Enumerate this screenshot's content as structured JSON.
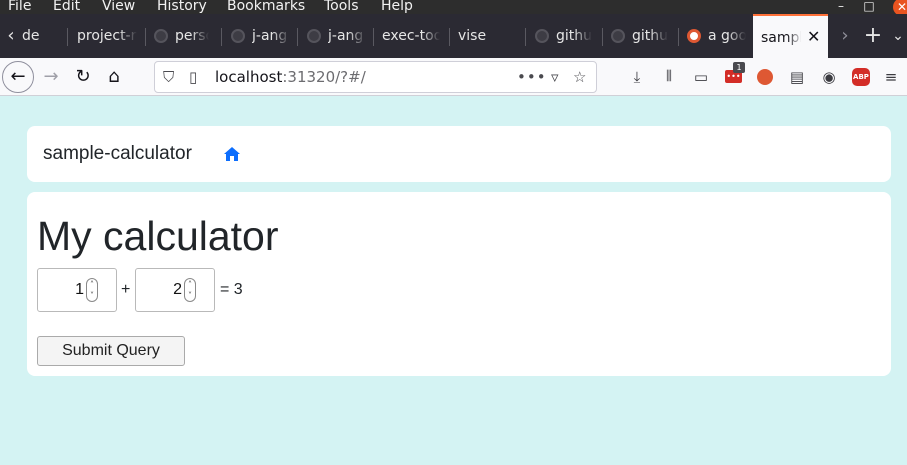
{
  "menubar": {
    "items": [
      "File",
      "Edit",
      "View",
      "History",
      "Bookmarks",
      "Tools",
      "Help"
    ]
  },
  "tabs": [
    {
      "label": "de"
    },
    {
      "label": "project-r"
    },
    {
      "label": "perso"
    },
    {
      "label": "j-ang"
    },
    {
      "label": "j-ang"
    },
    {
      "label": "exec-tool"
    },
    {
      "label": "vise"
    },
    {
      "label": "githu"
    },
    {
      "label": "githu"
    },
    {
      "label": "a goo"
    }
  ],
  "active_tab": {
    "label": "sample-calculator",
    "close": "✕"
  },
  "navbar": {
    "url_host": "localhost",
    "url_rest": ":31320/?#/",
    "notification_count": "1"
  },
  "app": {
    "brand": "sample-calculator",
    "title": "My calculator",
    "a": "1",
    "op_plus": "+",
    "b": "2",
    "result": "= 3",
    "submit_label": "Submit Query"
  },
  "colors": {
    "page_bg": "#d4f3f3",
    "home_icon": "#0d6efd",
    "active_tab_accent": "#ff7139"
  }
}
